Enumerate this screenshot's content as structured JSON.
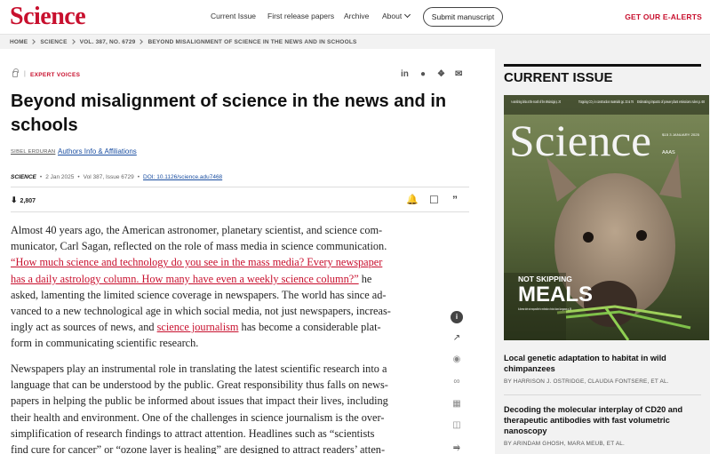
{
  "header": {
    "logo": "Science",
    "nav": [
      "Current Issue",
      "First release papers",
      "Archive",
      "About"
    ],
    "submit": "Submit manuscript",
    "ealerts": "GET OUR E-ALERTS"
  },
  "breadcrumb": [
    "HOME",
    "SCIENCE",
    "VOL. 387, NO. 6729",
    "BEYOND MISALIGNMENT OF SCIENCE IN THE NEWS AND IN SCHOOLS"
  ],
  "article": {
    "kicker": "EXPERT VOICES",
    "title": "Beyond misalignment of science in the news and in schools",
    "author": "SIBEL ERDURAN",
    "author_info": "Authors Info & Affiliations",
    "journal": "SCIENCE",
    "date": "2 Jan 2025",
    "volume": "Vol 387, Issue 6729",
    "doi": "DOI: 10.1126/science.adu7468",
    "downloads": "2,807",
    "p1": [
      "Almost 40 years ago, the American astronomer, planetary scientist, and science com-",
      "municator, Carl Sagan, reflected on the role of mass media in science communication.",
      "“How much science and technology do you see in the mass media? Every newspaper",
      "has a daily astrology column. How many have even a weekly science column?”",
      " he",
      "asked, lamenting the limited science coverage in newspapers. The world has since ad-",
      "vanced to a new technological age in which social media, not just newspapers, increas-",
      "ingly act as sources of news, and ",
      "science journalism",
      " has become a considerable plat-",
      "form in communicating scientific research."
    ],
    "p2": [
      "Newspapers play an instrumental role in translating the latest scientific research into a",
      "language that can be understood by the public. Great responsibility thus falls on news-",
      "papers in helping the public be informed about issues that impact their lives, including",
      "their health and environment. One of the challenges in science journalism is the over-",
      "simplification of research findings to attract attention. Headlines such as “scientists",
      "find cure for cancer” or “ozone layer is healing” are designed to attract readers’ atten-"
    ]
  },
  "sidebar": {
    "current_issue": "CURRENT ISSUE",
    "cover": {
      "masthead": "Science",
      "teasers": [
        "A vanishing delta at the mouth of the Mississippi p. 20",
        "Trapping CO₂ in construction materials pp. 33 & 76",
        "Estimating impacts of power plant emissions rules p. 68"
      ],
      "issue": "$15\n3 JANUARY 2025",
      "aaas": "AAAS",
      "headline_small": "NOT SKIPPING",
      "headline_big": "MEALS",
      "caption": "A diverse diet not responsible for extinction of short-faced kangaroos p. 56"
    },
    "items": [
      {
        "title": "Local genetic adaptation to habitat in wild chimpanzees",
        "authors": "BY HARRISON J. OSTRIDGE, CLAUDIA FONTSERE, ET AL."
      },
      {
        "title": "Decoding the molecular interplay of CD20 and therapeutic antibodies with fast volumetric nanoscopy",
        "authors": "BY ARINDAM GHOSH, MARA MEUB, ET AL."
      }
    ]
  },
  "colors": {
    "brand": "#c8102e",
    "link": "#1a4ea1"
  }
}
